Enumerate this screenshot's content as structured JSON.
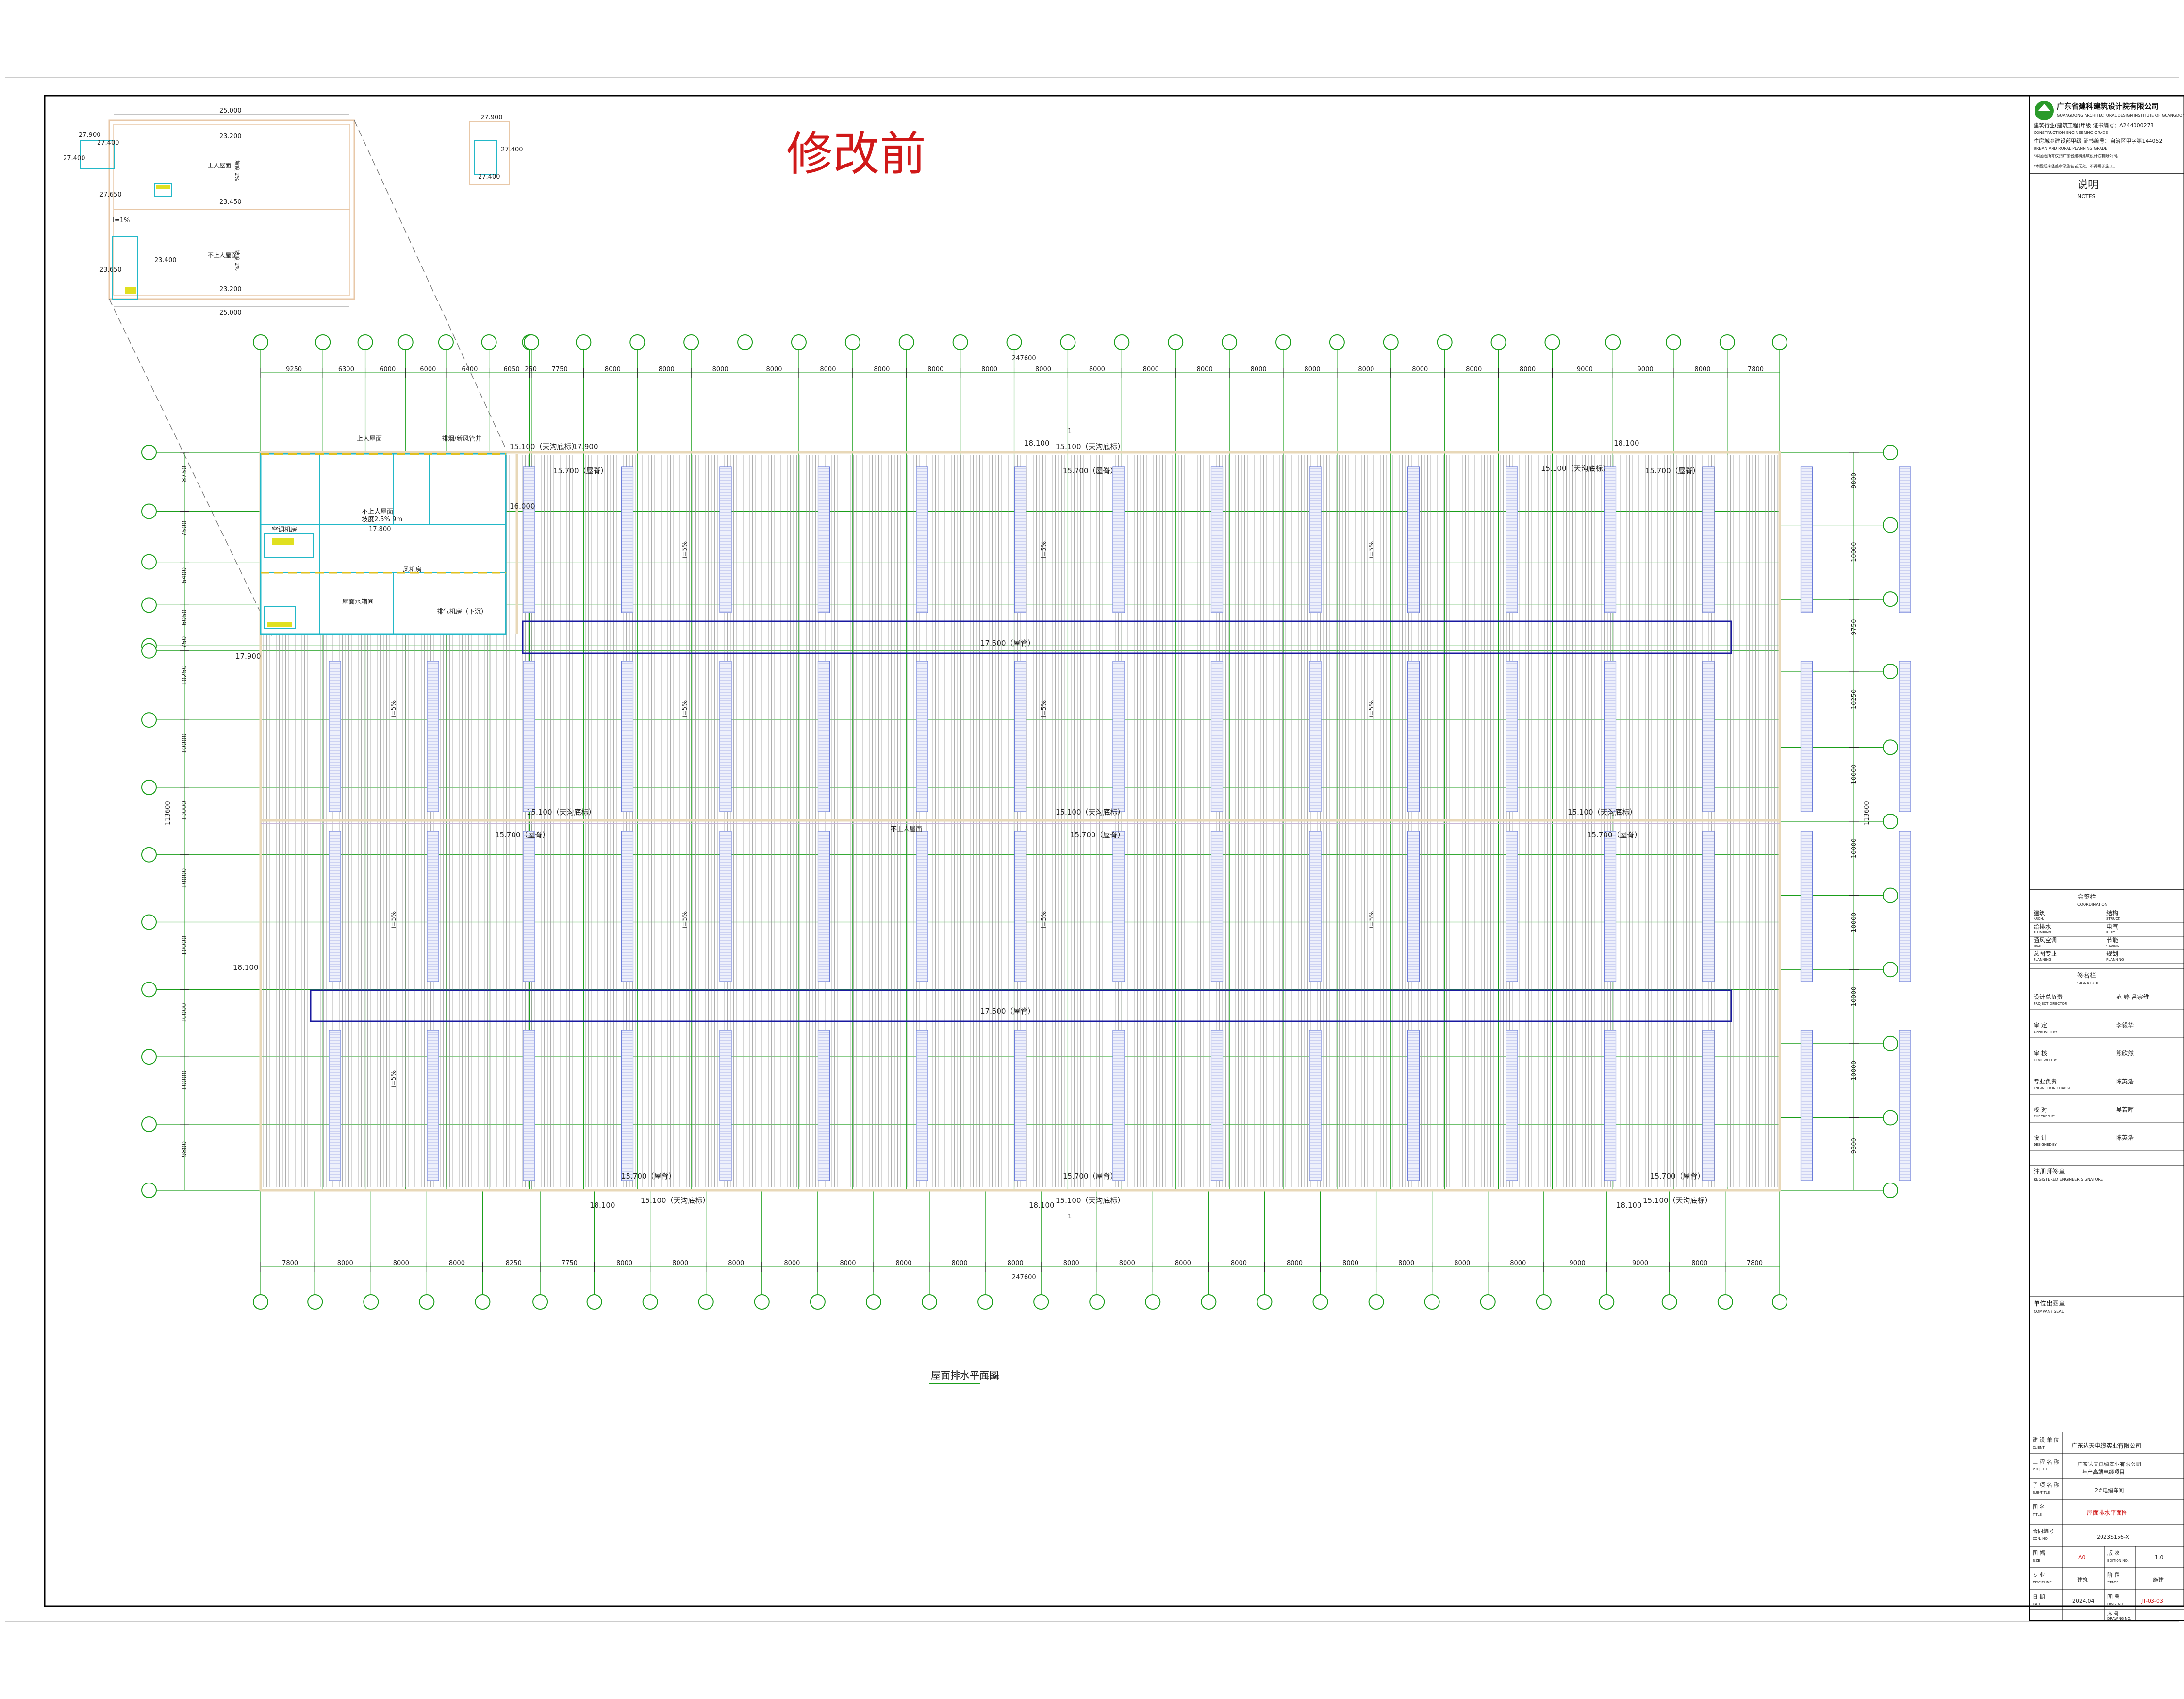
{
  "stamp_title": "修改前",
  "drawing": {
    "caption": "屋面排水平面图",
    "scale": "1:200",
    "overall_width": "247600",
    "section_mark": "1",
    "top_dims": [
      "9250",
      "6300",
      "6000",
      "6000",
      "6400",
      "6050",
      "250",
      "7750",
      "8000",
      "8000",
      "8000",
      "8000",
      "8000",
      "8000",
      "8000",
      "8000",
      "8000",
      "8000",
      "8000",
      "8000",
      "8000",
      "8000",
      "8000",
      "8000",
      "8000",
      "8000",
      "9000",
      "9000",
      "8000",
      "7800"
    ],
    "bottom_dims": [
      "7800",
      "8000",
      "8000",
      "8000",
      "8250",
      "7750",
      "8000",
      "8000",
      "8000",
      "8000",
      "8000",
      "8000",
      "8000",
      "8000",
      "8000",
      "8000",
      "8000",
      "8000",
      "8000",
      "8000",
      "8000",
      "8000",
      "8000",
      "9000",
      "9000",
      "8000",
      "7800"
    ],
    "left_dims": [
      "8750",
      "7500",
      "6400",
      "6050",
      "750",
      "10250",
      "10000",
      "10000",
      "10000",
      "10000",
      "10000",
      "10000",
      "9800"
    ],
    "left_total": "113600",
    "right_dims": [
      "9800",
      "10000",
      "9750",
      "10250",
      "10000",
      "10000",
      "10000",
      "10000",
      "10000",
      "9800"
    ],
    "right_total": "113600",
    "elevations": {
      "e17900a": "17.900",
      "e17900b": "17.900",
      "e16000": "16.000",
      "e18100a": "18.100",
      "e18100b": "18.100",
      "e18100c": "18.100",
      "e18100d": "18.100",
      "e18100e": "18.100",
      "e18100f": "18.100",
      "e15100_top1": "15.100（天沟底标）",
      "e15100_top2": "15.100（天沟底标）",
      "e15700_top1": "15.700（屋脊）",
      "e15700_top2": "15.700（屋脊）",
      "e15100_top3": "15.100（天沟底标）",
      "e15700_top3": "15.700（屋脊）",
      "e17500a": "17.500（屋脊）",
      "e17500b": "17.500（屋脊）",
      "e15100_mid1": "15.100（天沟底标）",
      "e15100_mid2": "15.100（天沟底标）",
      "e15100_mid3": "15.100（天沟底标）",
      "e15700_mid1": "15.700（屋脊）",
      "e15700_mid2": "15.700（屋脊）",
      "e15700_mid3": "15.700（屋脊）",
      "e15700_bot1": "15.700（屋脊）",
      "e15100_bot1": "15.100（天沟底标）",
      "e15700_bot2": "15.700（屋脊）",
      "e15100_bot2": "15.100（天沟底标）",
      "e15700_bot3": "15.700（屋脊）",
      "e15100_bot3": "15.100（天沟底标）"
    },
    "slope_labels": [
      "i=5%",
      "i=5%",
      "i=5%",
      "i=5%",
      "i=5%",
      "i=5%",
      "i=5%",
      "i=5%",
      "i=5%",
      "i=5%",
      "i=5%",
      "i=5%"
    ],
    "office_rooms": [
      "上人屋面",
      "排烟/新风管井",
      "空调机房",
      "不上人屋面",
      "坡度2.5% 9m",
      "风机房",
      "屋面水箱间",
      "排气机房（下沉）"
    ],
    "office_elev": "17.800",
    "mid_label": "不上人屋面"
  },
  "inset": {
    "dim_top": "25.000",
    "dim_top2": "23.200",
    "dim_mid": "23.450",
    "dim_bottom": "23.200",
    "dim_bottom2": "25.000",
    "e27900a": "27.900",
    "e27400a": "27.400",
    "e27400b": "27.400",
    "e27650": "27.650",
    "e23400": "23.400",
    "e23650": "23.650",
    "e27900b": "27.900",
    "e27400c": "27.400",
    "e27400d": "27.400",
    "room1": "上人屋面",
    "room2": "不上人屋面",
    "note": "I=1%",
    "slope1": "坡度 2%",
    "slope2": "坡度 2%"
  },
  "titleblock": {
    "company_cn": "广东省建科建筑设计院有限公司",
    "company_en": "GUANGDONG ARCHITECTURAL DESIGN INSTITUTE OF GUANGDONG PROVINCE CO.,LTD.",
    "license1": "建筑行业(建筑工程)甲级 证书编号：A244000278",
    "license1_en": "CONSTRUCTION ENGINEERING GRADE",
    "license2": "住房城乡建设部甲级 证书编号：自治区甲字第144052",
    "license2_en": "URBAN AND RURAL PLANNING GRADE",
    "warn1": "*本图纸所有权归广东省建科建筑设计院有限公司。",
    "warn2": "*本图纸未经盖章及签名者无效，不得用于施工。",
    "notes_title": "说明",
    "notes_en": "NOTES",
    "coord_title": "会签栏",
    "coord_en": "COORDINATION",
    "disciplines": [
      {
        "cn": "建筑",
        "en": "ARCH.",
        "cn2": "结构",
        "en2": "STRUCT."
      },
      {
        "cn": "给排水",
        "en": "PLUMBING",
        "cn2": "电气",
        "en2": "ELEC."
      },
      {
        "cn": "通风空调",
        "en": "HVAC",
        "cn2": "节能",
        "en2": "SAVING"
      },
      {
        "cn": "总图专业",
        "en": "PLANNING",
        "cn2": "规划",
        "en2": "PLANNING"
      }
    ],
    "sign_title": "签名栏",
    "sign_en": "SIGNATURE",
    "roles": [
      {
        "cn": "设计总负责",
        "en": "PROJECT DIRECTOR",
        "name": "范 婷    吕宗维"
      },
      {
        "cn": "审 定",
        "en": "APPROVED BY",
        "name": "李毅华"
      },
      {
        "cn": "审 核",
        "en": "REVIEWED BY",
        "name": "熊欣然"
      },
      {
        "cn": "专业负责",
        "en": "ENGINEER IN CHARGE",
        "name": "陈英浩"
      },
      {
        "cn": "校 对",
        "en": "CHECKED BY",
        "name": "吴若晖"
      },
      {
        "cn": "设 计",
        "en": "DESIGNED BY",
        "name": "陈英浩"
      }
    ],
    "reg_title": "注册师签章",
    "reg_en": "REGISTERED ENGINEER SIGNATURE",
    "seal_title": "单位出图章",
    "seal_en": "COMPANY SEAL",
    "client_label": "建 设 单 位",
    "client_en": "CLIENT",
    "client_value": "广东达天电缆实业有限公司",
    "project_label": "工 程 名 称",
    "project_en": "PROJECT",
    "project_value1": "广东达天电缆实业有限公司",
    "project_value2": "年产高端电缆项目",
    "subtitle_label": "子 项 名 称",
    "subtitle_en": "SUB-TITLE",
    "subtitle_value": "2#电缆车间",
    "title_label": "图 名",
    "title_en": "TITLE",
    "title_value": "屋面排水平面图",
    "contract_label": "合同编号",
    "contract_en": "CON. NO.",
    "contract_value": "2023S156-X",
    "size_label": "图 幅",
    "size_en": "SIZE",
    "size_value": "A0",
    "version_label": "版 次",
    "version_en": "EDITION NO.",
    "version_value": "1.0",
    "disc_label": "专 业",
    "disc_en": "DISCIPLINE",
    "disc_value": "建筑",
    "stage_label": "阶 段",
    "stage_en": "STAGE",
    "stage_value": "施建",
    "date_label": "日 期",
    "date_en": "DATE",
    "date_value": "2024.04",
    "dwg_label": "图 号",
    "dwg_en": "DWG. NO.",
    "dwg_value": "JT-03-03",
    "seq_label": "序 号",
    "seq_en": "DRAWING NO."
  },
  "colors": {
    "grid": "#1a9e1a",
    "outline": "#e8d8b8",
    "ridge": "#1a1aa0",
    "office": "#22b8c8",
    "office_accent": "#e0c020",
    "stamp": "#d01818",
    "drain": "#6a7bd8",
    "logo": "#2a9a2a"
  }
}
